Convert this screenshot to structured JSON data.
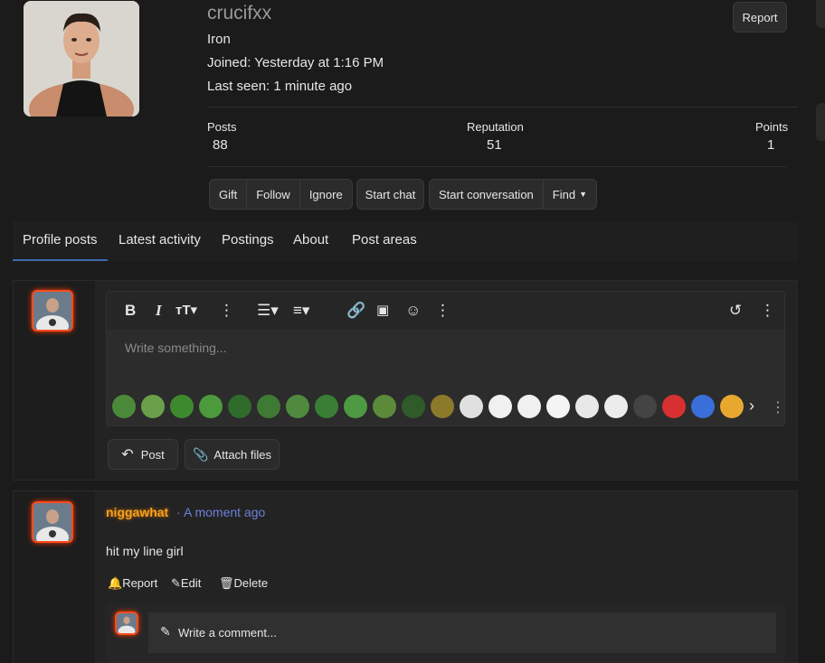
{
  "profile": {
    "username": "crucifxx",
    "rank": "Iron",
    "joined": "Joined: Yesterday at 1:16 PM",
    "last_seen": "Last seen: 1 minute ago",
    "report_label": "Report"
  },
  "stats": [
    {
      "label": "Posts",
      "value": "88"
    },
    {
      "label": "Reputation",
      "value": "51"
    },
    {
      "label": "Points",
      "value": "1"
    }
  ],
  "actions": {
    "gift": "Gift",
    "follow": "Follow",
    "ignore": "Ignore",
    "start_chat": "Start chat",
    "start_conversation": "Start conversation",
    "find": "Find"
  },
  "tabs": [
    {
      "label": "Profile posts"
    },
    {
      "label": "Latest activity"
    },
    {
      "label": "Postings"
    },
    {
      "label": "About"
    },
    {
      "label": "Post areas"
    }
  ],
  "editor": {
    "placeholder": "Write something...",
    "post_label": "Post",
    "attach_label": "Attach files"
  },
  "emoji_colors": [
    "#4b8a3a",
    "#6aa04a",
    "#3d8a2e",
    "#4c9a3b",
    "#2f6b2a",
    "#3f7a35",
    "#4f8a3f",
    "#3a7e36",
    "#4e9a42",
    "#5a8a3a",
    "#2f5a2a",
    "#8a7a2a",
    "#e0e0e0",
    "#f0f0f0",
    "#f0f0f0",
    "#f4f4f4",
    "#e8e8e8",
    "#ececec",
    "#444444",
    "#d83030",
    "#3a6ed8",
    "#e8a830"
  ],
  "post": {
    "author": "niggawhat",
    "separator": "·",
    "time": "A moment ago",
    "body": "hit my line girl",
    "report": "Report",
    "edit": "Edit",
    "delete": "Delete",
    "comment_placeholder": "Write a comment..."
  },
  "colors": {
    "accent_blue": "#6c7fd8",
    "author_orange": "#f6a31f",
    "tab_active": "#3f6ab0"
  }
}
